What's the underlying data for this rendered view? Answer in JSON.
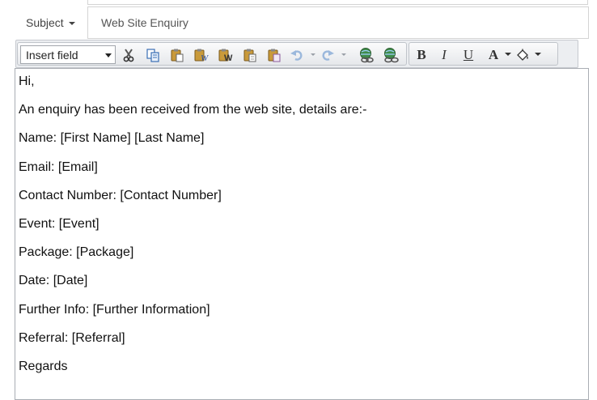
{
  "subject": {
    "dropdown_label": "Subject",
    "value": "Web Site Enquiry"
  },
  "toolbar": {
    "insert_field_label": "Insert field",
    "buttons": [
      "cut-icon",
      "copy-icon",
      "paste-icon",
      "paste-text-icon",
      "paste-word-icon",
      "paste-html-icon",
      "paste-special-icon",
      "undo-icon",
      "redo-icon",
      "insert-link-icon",
      "remove-link-icon"
    ],
    "bold_glyph": "B",
    "italic_glyph": "I",
    "underline_glyph": "U",
    "font_color_glyph": "A"
  },
  "body": {
    "lines": [
      "Hi,",
      "An enquiry has been received from the web site, details are:-",
      "Name: [First Name] [Last Name]",
      "Email: [Email]",
      "Contact Number: [Contact Number]",
      "Event: [Event]",
      "Package: [Package]",
      "Date: [Date]",
      "Further Info: [Further Information]",
      "Referral: [Referral]",
      "Regards"
    ]
  }
}
